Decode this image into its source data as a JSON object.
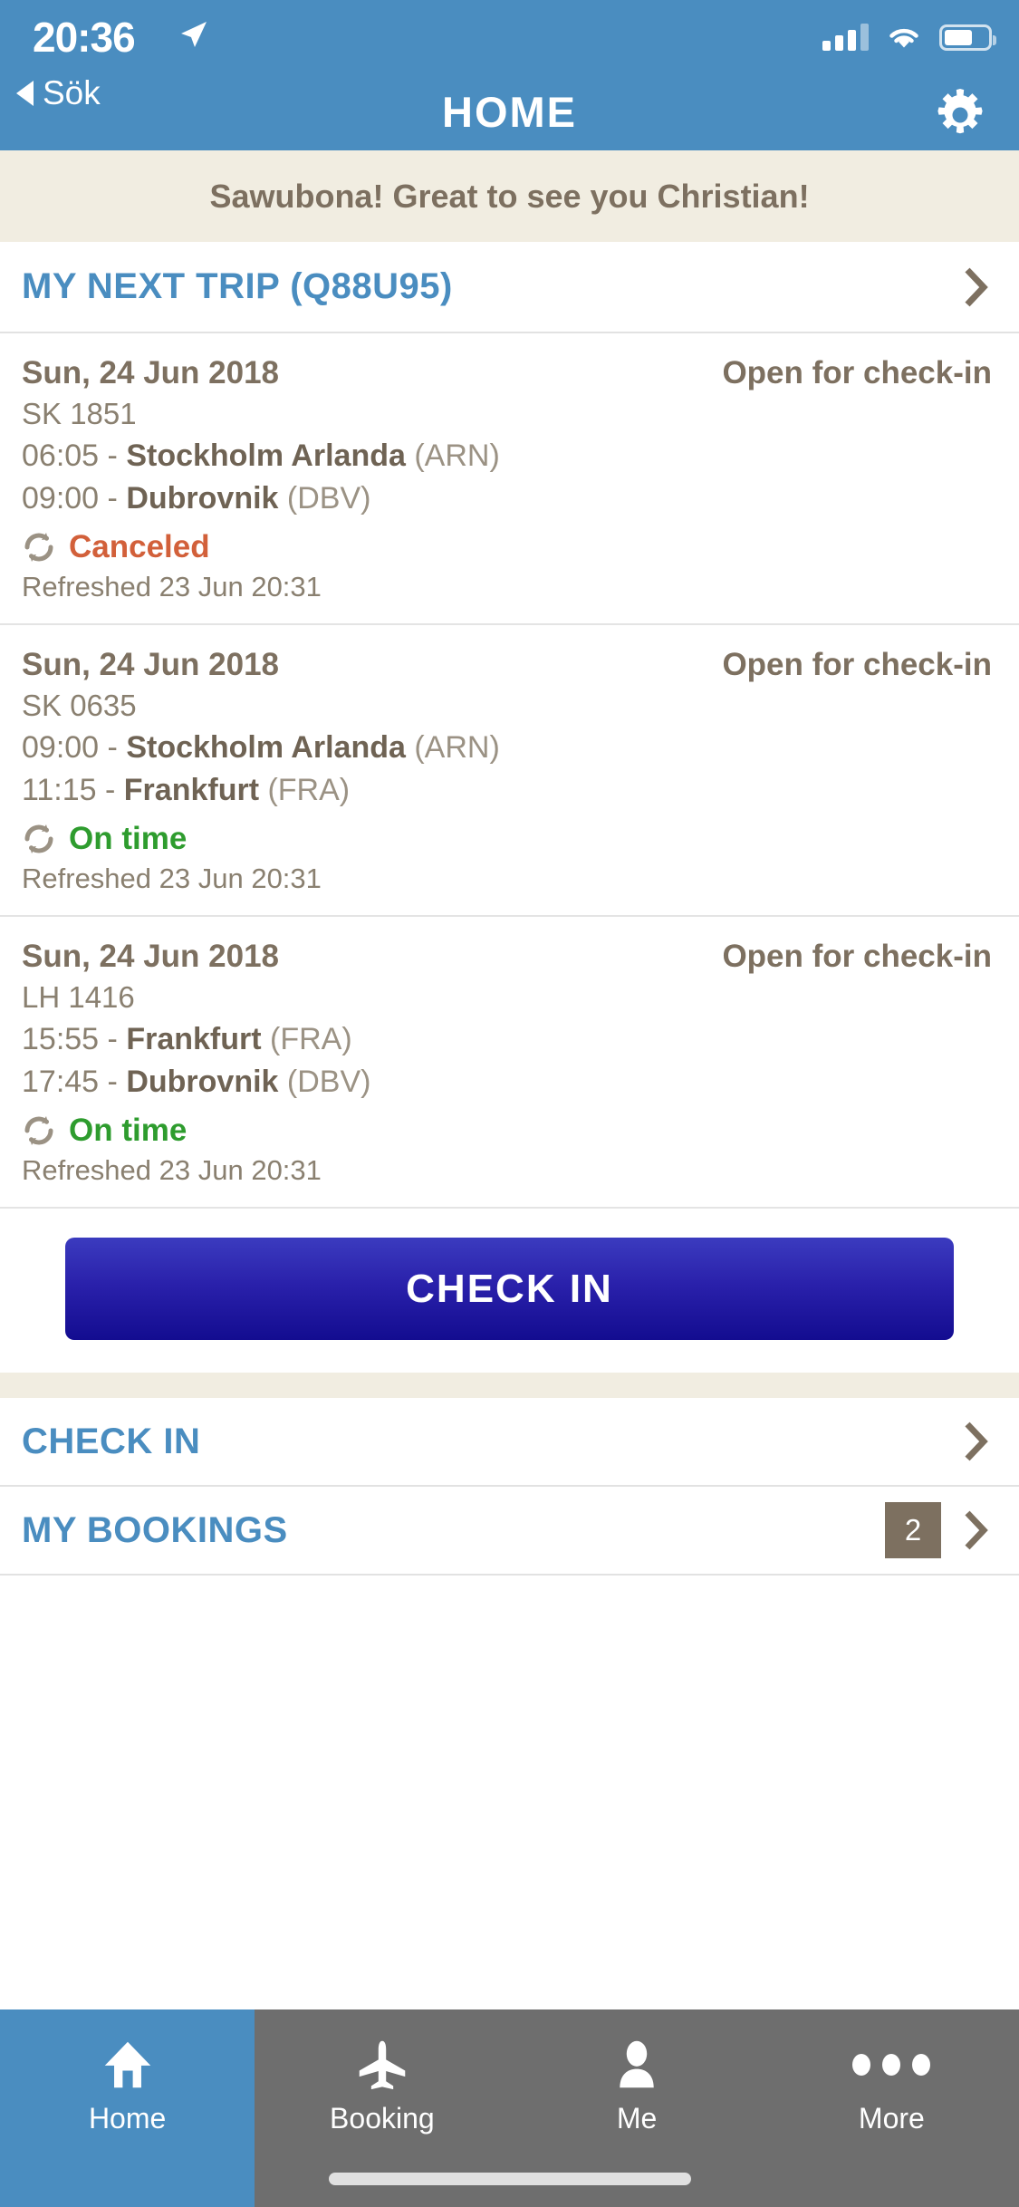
{
  "status_bar": {
    "time": "20:36",
    "location_icon": "location-arrow-icon",
    "signal_icon": "cellular-signal-icon",
    "wifi_icon": "wifi-icon",
    "battery_icon": "battery-icon"
  },
  "nav": {
    "back_label": "Sök",
    "title": "HOME",
    "settings_icon": "gear-icon"
  },
  "greeting": {
    "text": "Sawubona! Great to see you Christian!"
  },
  "next_trip": {
    "label": "MY NEXT TRIP (Q88U95)",
    "chevron_icon": "chevron-right-icon"
  },
  "flights": [
    {
      "date": "Sun, 24 Jun 2018",
      "checkin_status": "Open for check-in",
      "flight_number": "SK 1851",
      "depart_time": "06:05",
      "depart_city": "Stockholm Arlanda",
      "depart_code": "(ARN)",
      "arrive_time": "09:00",
      "arrive_city": "Dubrovnik",
      "arrive_code": "(DBV)",
      "status": "Canceled",
      "status_color": "#d2603a",
      "status_icon": "refresh-icon",
      "refreshed": "Refreshed 23 Jun 20:31"
    },
    {
      "date": "Sun, 24 Jun 2018",
      "checkin_status": "Open for check-in",
      "flight_number": "SK 0635",
      "depart_time": "09:00",
      "depart_city": "Stockholm Arlanda",
      "depart_code": "(ARN)",
      "arrive_time": "11:15",
      "arrive_city": "Frankfurt",
      "arrive_code": "(FRA)",
      "status": "On time",
      "status_color": "#2e9c2e",
      "status_icon": "refresh-icon",
      "refreshed": "Refreshed 23 Jun 20:31"
    },
    {
      "date": "Sun, 24 Jun 2018",
      "checkin_status": "Open for check-in",
      "flight_number": "LH 1416",
      "depart_time": "15:55",
      "depart_city": "Frankfurt",
      "depart_code": "(FRA)",
      "arrive_time": "17:45",
      "arrive_city": "Dubrovnik",
      "arrive_code": "(DBV)",
      "status": "On time",
      "status_color": "#2e9c2e",
      "status_icon": "refresh-icon",
      "refreshed": "Refreshed 23 Jun 20:31"
    }
  ],
  "primary_button": {
    "label": "CHECK IN"
  },
  "menu_rows": [
    {
      "label": "CHECK IN",
      "badge": "",
      "chevron_icon": "chevron-right-icon"
    },
    {
      "label": "MY BOOKINGS",
      "badge": "2",
      "chevron_icon": "chevron-right-icon"
    }
  ],
  "tabs": [
    {
      "label": "Home",
      "icon": "home-icon",
      "active": true
    },
    {
      "label": "Booking",
      "icon": "airplane-icon",
      "active": false
    },
    {
      "label": "Me",
      "icon": "person-icon",
      "active": false
    },
    {
      "label": "More",
      "icon": "ellipsis-icon",
      "active": false
    }
  ],
  "colors": {
    "header_blue": "#4a8dc0",
    "banner_cream": "#f1ede1",
    "text_brown": "#7d7060",
    "link_blue": "#4a8dc0",
    "button_indigo": "#2a21ab",
    "tabbar_gray": "#6e6e6e"
  }
}
